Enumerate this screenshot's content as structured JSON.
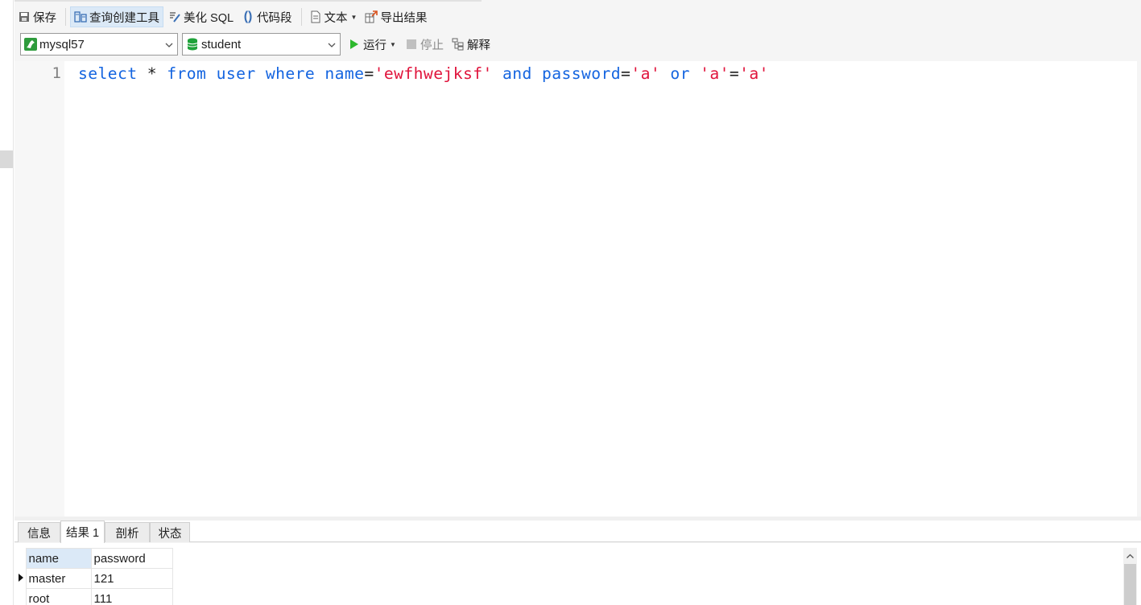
{
  "toolbar": {
    "save_label": "保存",
    "query_builder_label": "查询创建工具",
    "beautify_label": "美化 SQL",
    "snippet_label": "代码段",
    "text_label": "文本",
    "export_label": "导出结果"
  },
  "connection": {
    "selected": "mysql57",
    "icon": "mysql-dolphin-icon",
    "accent": "#2e9b3c"
  },
  "database": {
    "selected": "student",
    "icon": "database-icon",
    "accent": "#1fa23a"
  },
  "run_controls": {
    "run_label": "运行",
    "stop_label": "停止",
    "explain_label": "解释",
    "run_color": "#2db82d"
  },
  "editor": {
    "line_number": "1",
    "tokens": {
      "t1": "select",
      "t2": " * ",
      "t3": "from",
      "t4": " ",
      "t5": "user",
      "t6": " ",
      "t7": "where",
      "t8": " ",
      "t9": "name",
      "t10": "=",
      "t11": "'ewfhwejksf'",
      "t12": " ",
      "t13": "and",
      "t14": " ",
      "t15": "password",
      "t16": "=",
      "t17": "'a'",
      "t18": " ",
      "t19": "or",
      "t20": " ",
      "t21": "'a'",
      "t22": "=",
      "t23": "'a'"
    },
    "keyword_color": "#1565e0",
    "string_color": "#e0143c"
  },
  "result_tabs": {
    "info": "信息",
    "result1": "结果 1",
    "profile": "剖析",
    "status": "状态"
  },
  "result_grid": {
    "columns": [
      "name",
      "password"
    ],
    "rows": [
      [
        "master",
        "121"
      ],
      [
        "root",
        "111"
      ]
    ]
  }
}
